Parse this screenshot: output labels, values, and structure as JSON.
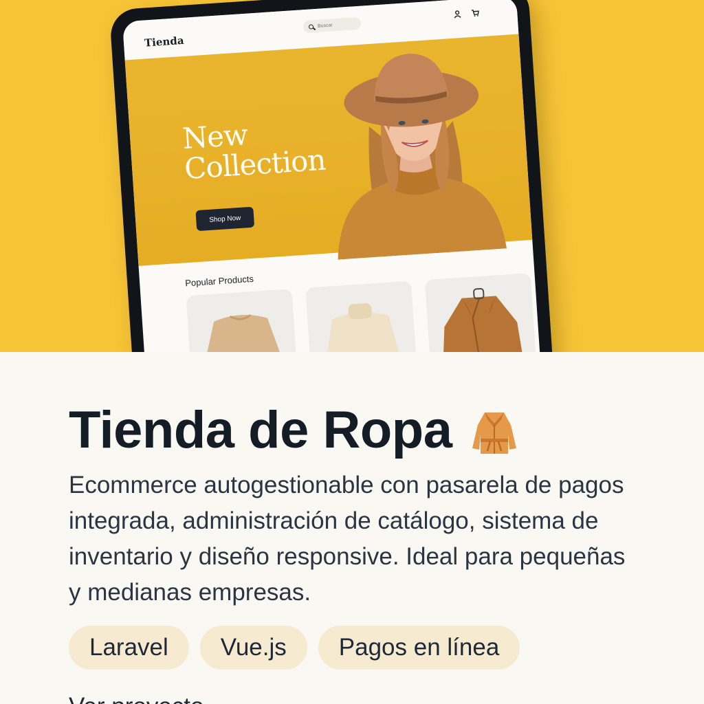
{
  "store": {
    "logo": "Tienda",
    "search_placeholder": "Buscar",
    "nav_icons": [
      "account-icon",
      "cart-icon"
    ],
    "banner": {
      "title": "New Collection",
      "cta": "Shop Now"
    },
    "popular_title": "Popular Products",
    "products": [
      {
        "name": "beige-sweater",
        "color": "#d9b58b"
      },
      {
        "name": "cream-turtleneck",
        "color": "#efe2c6"
      },
      {
        "name": "camel-coat",
        "color": "#b87434"
      }
    ]
  },
  "project": {
    "title": "Tienda de Ropa",
    "title_icon": "coat-icon",
    "description": "Ecommerce autogestionable con pasarela de pagos integrada, administración de catálogo, sistema de inventario y diseño responsive. Ideal para pequeñas y medianas empresas.",
    "tags": [
      "Laravel",
      "Vue.js",
      "Pagos en línea"
    ],
    "more_link": "Ver proyecto →"
  },
  "colors": {
    "hero_bg": "#f7c437",
    "banner": "#e9b22b",
    "tag_bg": "#f6ead0",
    "text_dark": "#141c26"
  }
}
